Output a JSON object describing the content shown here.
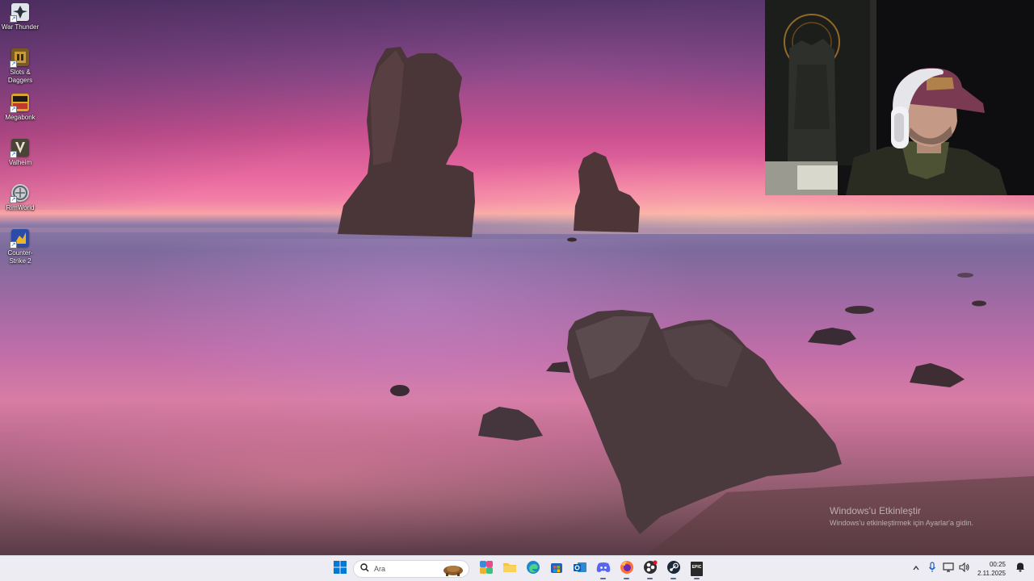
{
  "desktop": {
    "icons": [
      {
        "label": "War Thunder",
        "icon": "war-thunder-icon",
        "color": "#d8dde6"
      },
      {
        "label": "Slots & Daggers",
        "icon": "slots-daggers-icon",
        "color": "#7a5a22"
      },
      {
        "label": "Megabonk",
        "icon": "megabonk-icon",
        "color": "#d7a62a"
      },
      {
        "label": "Valheim",
        "icon": "valheim-icon",
        "color": "#4a4438"
      },
      {
        "label": "RimWorld",
        "icon": "rimworld-icon",
        "color": "#c9cdd2"
      },
      {
        "label": "Counter-Strike 2",
        "icon": "counter-strike-2-icon",
        "color": "#2a4ca8"
      }
    ]
  },
  "watermark": {
    "title": "Windows'u Etkinleştir",
    "subtitle": "Windows'u etkinleştirmek için Ayarlar'a gidin."
  },
  "taskbar": {
    "search_placeholder": "Ara",
    "apps": [
      {
        "name": "start-button",
        "icon": "windows-start-icon"
      },
      {
        "name": "copilot",
        "icon": "copilot-icon"
      },
      {
        "name": "file-explorer",
        "icon": "folder-icon"
      },
      {
        "name": "edge",
        "icon": "edge-icon"
      },
      {
        "name": "store",
        "icon": "store-icon"
      },
      {
        "name": "outlook",
        "icon": "outlook-icon"
      },
      {
        "name": "discord",
        "icon": "discord-icon"
      },
      {
        "name": "firefox",
        "icon": "firefox-icon"
      },
      {
        "name": "obs",
        "icon": "obs-icon"
      },
      {
        "name": "steam",
        "icon": "steam-icon"
      },
      {
        "name": "epic-games",
        "icon": "epic-games-icon"
      }
    ],
    "epic_label": "EPIC",
    "accent": "#0078d4",
    "clock": {
      "time": "00:25",
      "date": "2.11.2025"
    }
  }
}
